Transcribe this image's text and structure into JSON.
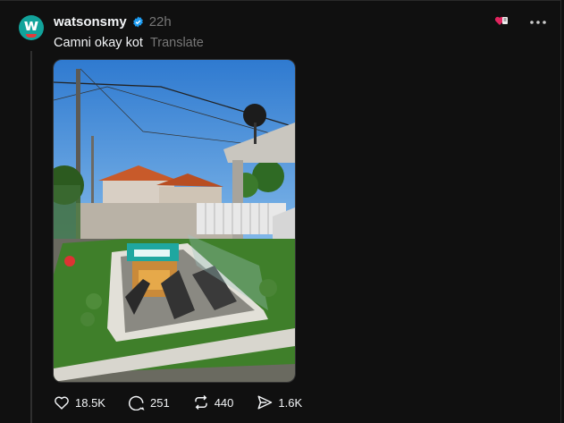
{
  "post": {
    "username": "watsonsmy",
    "time": "22h",
    "caption": "Camni okay kot",
    "translate_label": "Translate",
    "avatar_letter": "w",
    "image": {
      "description_colors": {
        "sky": "#4a8fd6",
        "grass": "#3f7f2a",
        "roof": "#c85a2a",
        "signage": "#1fa7a0"
      }
    },
    "actions": {
      "likes": "18.5K",
      "comments": "251",
      "reposts": "440",
      "shares": "1.6K"
    }
  },
  "colors": {
    "background": "#101010",
    "text": "#f3f5f7",
    "muted": "#777777",
    "verified": "#1d9bf0",
    "brand": "#12a39b"
  },
  "icons": {
    "top_badge": "heart-ticket-icon",
    "menu": "more-icon"
  }
}
